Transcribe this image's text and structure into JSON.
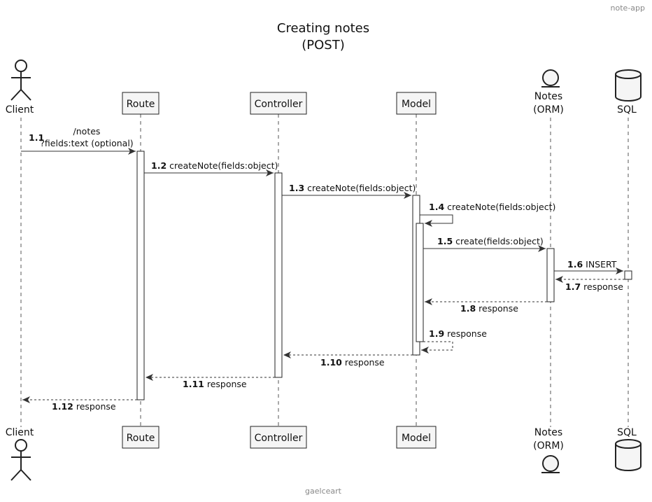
{
  "header": {
    "app": "note-app"
  },
  "diagram": {
    "title_line1": "Creating notes",
    "title_line2": "(POST)",
    "participants": {
      "client": "Client",
      "route": "Route",
      "controller": "Controller",
      "model": "Model",
      "notes_line1": "Notes",
      "notes_line2": "(ORM)",
      "sql": "SQL"
    },
    "messages": [
      {
        "num": "1.1",
        "line1": "/notes",
        "line2": "?fields:text (optional)"
      },
      {
        "num": "1.2",
        "text": "createNote(fields:object)"
      },
      {
        "num": "1.3",
        "text": "createNote(fields:object)"
      },
      {
        "num": "1.4",
        "text": "createNote(fields:object)"
      },
      {
        "num": "1.5",
        "text": "create(fields:object)"
      },
      {
        "num": "1.6",
        "text": "INSERT"
      },
      {
        "num": "1.7",
        "text": "response"
      },
      {
        "num": "1.8",
        "text": "response"
      },
      {
        "num": "1.9",
        "text": "response"
      },
      {
        "num": "1.10",
        "text": "response"
      },
      {
        "num": "1.11",
        "text": "response"
      },
      {
        "num": "1.12",
        "text": "response"
      }
    ]
  },
  "footer": {
    "author": "gaelceart"
  }
}
